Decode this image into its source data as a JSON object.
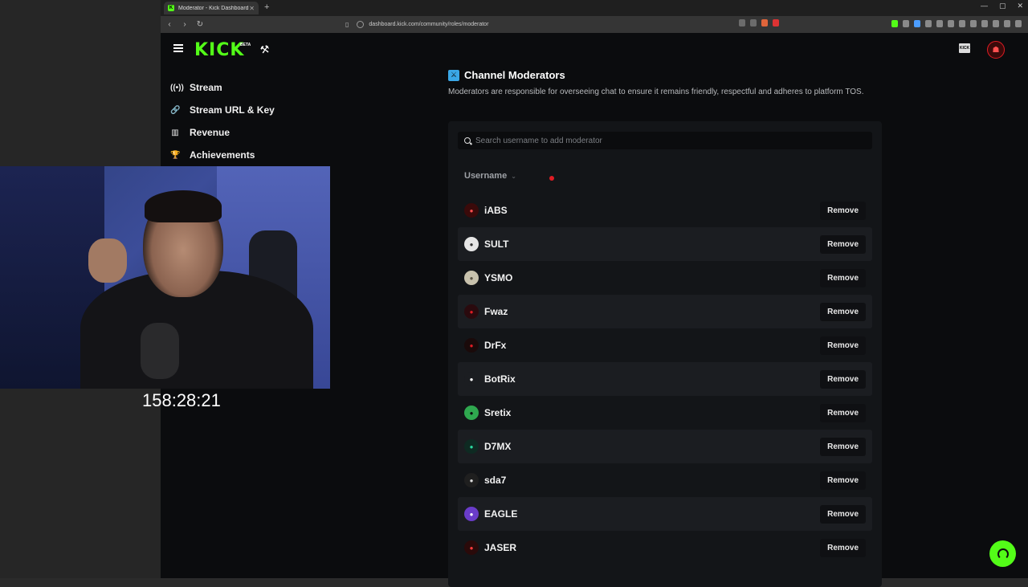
{
  "browser": {
    "tab_title": "Moderator - Kick Dashboard",
    "url": "dashboard.kick.com/community/roles/moderator"
  },
  "nav": {
    "logo": "KICK",
    "beta": "BETA",
    "user_badge": "KICK"
  },
  "sidebar": {
    "items": [
      {
        "label": "Stream",
        "icon": "broadcast-icon"
      },
      {
        "label": "Stream URL & Key",
        "icon": "link-icon"
      },
      {
        "label": "Revenue",
        "icon": "chart-icon"
      },
      {
        "label": "Achievements",
        "icon": "trophy-icon"
      }
    ]
  },
  "main": {
    "title": "Channel Moderators",
    "description": "Moderators are responsible for overseeing chat to ensure it remains friendly, respectful and adheres to platform TOS.",
    "search_placeholder": "Search username to add moderator",
    "column_header": "Username",
    "remove_label": "Remove",
    "moderators": [
      {
        "name": "iABS",
        "color": "#3a0a0a",
        "fg": "#ff5050"
      },
      {
        "name": "SULT",
        "color": "#e6e6e6",
        "fg": "#333333"
      },
      {
        "name": "YSMO",
        "color": "#c8c2ad",
        "fg": "#5a5444"
      },
      {
        "name": "Fwaz",
        "color": "#2a0a0e",
        "fg": "#e01c24"
      },
      {
        "name": "DrFx",
        "color": "#1a0a0a",
        "fg": "#e01c24"
      },
      {
        "name": "BotRix",
        "color": "#1b1d21",
        "fg": "#ffffff"
      },
      {
        "name": "Sretix",
        "color": "#2fa84f",
        "fg": "#0b0c0e"
      },
      {
        "name": "D7MX",
        "color": "#0e2a22",
        "fg": "#2bd9a0"
      },
      {
        "name": "sda7",
        "color": "#1f1f1f",
        "fg": "#dddddd"
      },
      {
        "name": "EAGLE",
        "color": "#6a3cc9",
        "fg": "#ffffff"
      },
      {
        "name": "JASER",
        "color": "#2a0a0a",
        "fg": "#ff3b3b"
      }
    ]
  },
  "overlay": {
    "timer": "158:28:21"
  },
  "colors": {
    "brand": "#53fc18",
    "accent_blue": "#3aa7e6"
  }
}
